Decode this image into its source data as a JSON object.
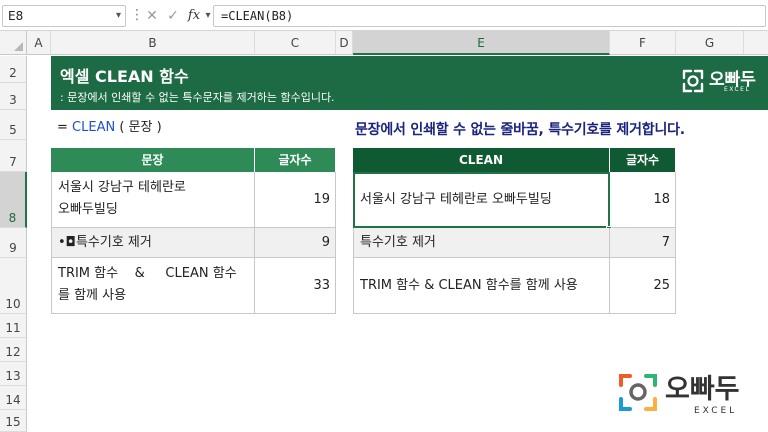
{
  "formula_bar": {
    "name_box": "E8",
    "cancel_icon": "✕",
    "confirm_icon": "✓",
    "fx_label": "fx",
    "formula": "=CLEAN(B8)"
  },
  "columns": [
    "A",
    "B",
    "C",
    "D",
    "E",
    "F",
    "G"
  ],
  "rows": [
    "2",
    "3",
    "5",
    "7",
    "8",
    "9",
    "10",
    "11",
    "12",
    "13",
    "14",
    "15"
  ],
  "banner": {
    "title": "엑셀 CLEAN 함수",
    "subtitle": ": 문장에서 인쇄할 수 없는 특수문자를 제거하는 함수입니다.",
    "logo_text": "오빠두",
    "logo_sub": "EXCEL"
  },
  "syntax": {
    "prefix": "= ",
    "fn": "CLEAN",
    "args": " ( 문장 )"
  },
  "description": "문장에서 인쇄할 수 없는 줄바꿈, 특수기호를 제거합니다.",
  "left_table": {
    "headers": [
      "문장",
      "글자수"
    ],
    "rows": [
      {
        "text_line1": "서울시 강남구 테헤란로",
        "text_line2": "오빠두빌딩",
        "count": "19"
      },
      {
        "text": "•◘특수기호 제거",
        "count": "9"
      },
      {
        "text_line1": "TRIM 함수    &     CLEAN 함수",
        "text_line2": "를 함께 사용",
        "count": "33"
      }
    ]
  },
  "right_table": {
    "headers": [
      "CLEAN",
      "글자수"
    ],
    "rows": [
      {
        "text": "서울시 강남구 테헤란로 오빠두빌딩",
        "count": "18"
      },
      {
        "text": "특수기호 제거",
        "count": "7"
      },
      {
        "text": "TRIM 함수 & CLEAN 함수를 함께 사용",
        "count": "25"
      }
    ]
  },
  "watermark": {
    "text": "오빠두",
    "sub": "EXCEL"
  },
  "colors": {
    "banner": "#1d6b45",
    "header_left": "#2e8b57",
    "header_right": "#0f5a32",
    "accent": "#217346",
    "desc": "#1a237e",
    "fn": "#1f4fd4"
  }
}
